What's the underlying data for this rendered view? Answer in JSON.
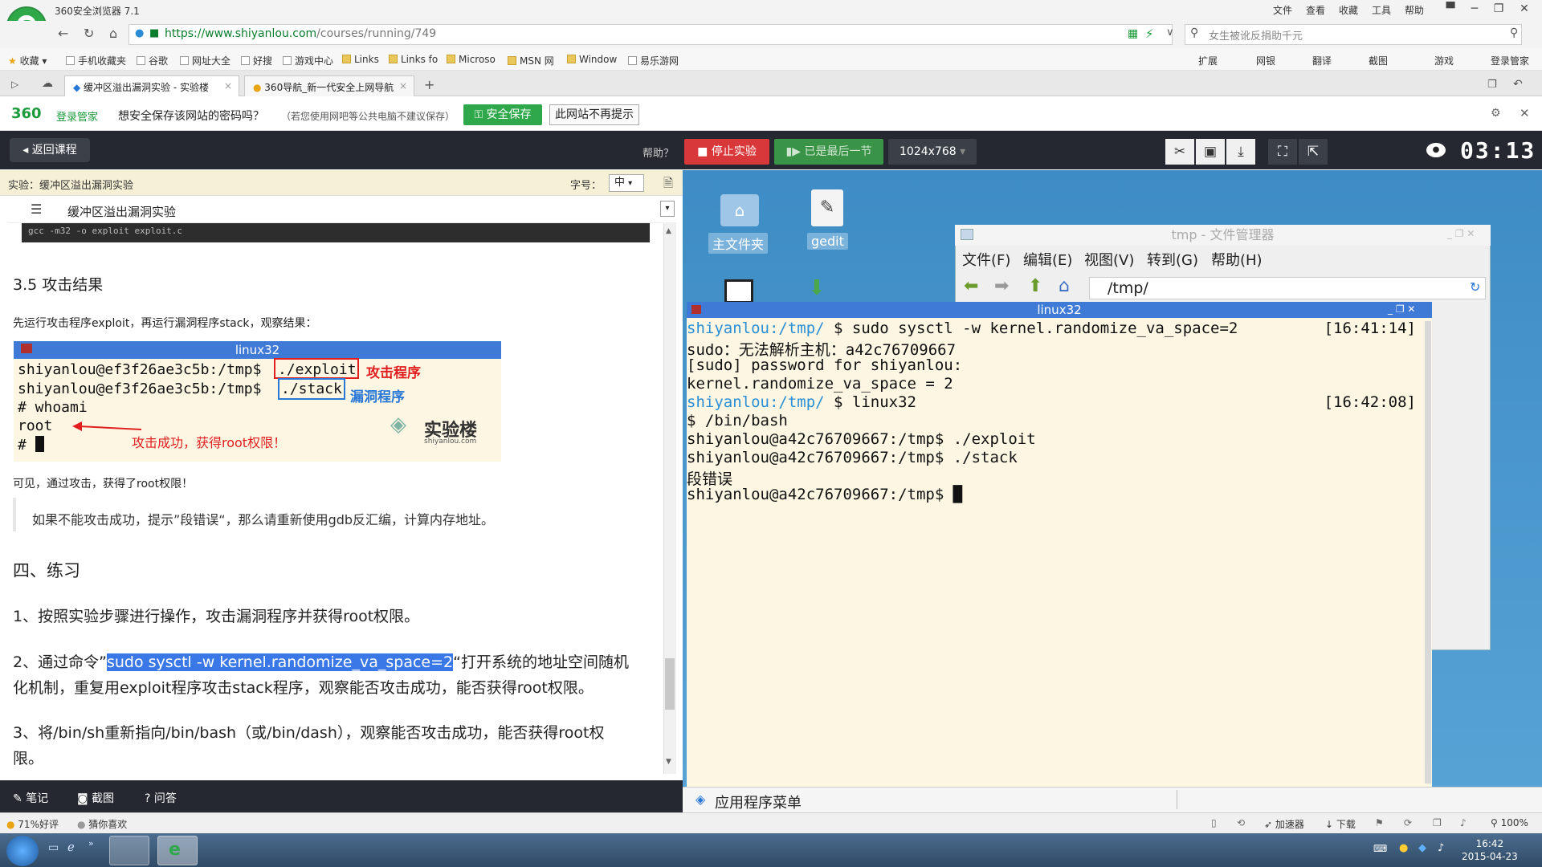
{
  "browser": {
    "title": "360安全浏览器 7.1",
    "menu": [
      "文件",
      "查看",
      "收藏",
      "工具",
      "帮助"
    ],
    "url_host": "https://www.shiyanlou.com",
    "url_path": "/courses/running/749",
    "search_placeholder": "女生被讹反捐助千元",
    "bookmarks": [
      "收藏",
      "手机收藏夹",
      "谷歌",
      "网址大全",
      "好搜",
      "游戏中心",
      "Links",
      "Links fo",
      "Microso",
      "MSN 网",
      "Window",
      "易乐游网"
    ],
    "toolbar_right": [
      "扩展",
      "网银",
      "翻译",
      "截图",
      "游戏",
      "登录管家"
    ],
    "tabs": [
      "缓冲区溢出漏洞实验 - 实验楼",
      "360导航_新一代安全上网导航"
    ],
    "pw_brand": "360",
    "pw_brand_label": "登录管家",
    "pw_question": "想安全保存该网站的密码吗？",
    "pw_note": "（若您使用网吧等公共电脑不建议保存）",
    "pw_save": "安全保存",
    "pw_never": "此网站不再提示"
  },
  "header": {
    "back": "返回课程",
    "help": "帮助？",
    "stop": "停止实验",
    "last": "已是最后一节",
    "resolution": "1024x768",
    "timer": "03:13"
  },
  "left": {
    "lab_title": "实验：缓冲区溢出漏洞实验",
    "font_label": "字号：",
    "font_value": "中",
    "doc_title": "缓冲区溢出漏洞实验",
    "code_line": "gcc -m32 -o exploit exploit.c",
    "h_result": "3.5 攻击结果",
    "p_run": "先运行攻击程序exploit，再运行漏洞程序stack，观察结果：",
    "shot": {
      "title": "linux32",
      "lines": [
        "shiyanlou@ef3f26ae3c5b:/tmp$ ",
        "shiyanlou@ef3f26ae3c5b:/tmp$ ",
        "# whoami",
        "root",
        "# "
      ],
      "cmd1": "./exploit",
      "cmd2": "./stack",
      "label1": "攻击程序",
      "label2": "漏洞程序",
      "annotation": "攻击成功，获得root权限！",
      "watermark": "实验楼",
      "watermark_url": "shiyanlou.com"
    },
    "p_seen": "可见，通过攻击，获得了root权限！",
    "quote": "如果不能攻击成功，提示”段错误“，那么请重新使用gdb反汇编，计算内存地址。",
    "h_practice": "四、练习",
    "item1": "1、按照实验步骤进行操作，攻击漏洞程序并获得root权限。",
    "item2a": "2、通过命令”",
    "item2cmd": "sudo sysctl -w kernel.randomize_va_space=2",
    "item2b": "“打开系统的地址空间随机",
    "item2c": "化机制，重复用exploit程序攻击stack程序，观察能否攻击成功，能否获得root权限。",
    "item3a": "3、将/bin/sh重新指向/bin/bash（或/bin/dash），观察能否攻击成功，能否获得root权",
    "item3b": "限。",
    "footer": [
      "笔记",
      "截图",
      "问答"
    ]
  },
  "desktop": {
    "icons": [
      "主文件夹",
      "gedit"
    ],
    "fm_title": "tmp - 文件管理器",
    "fm_menu": [
      "文件(F)",
      "编辑(E)",
      "视图(V)",
      "转到(G)",
      "帮助(H)"
    ],
    "fm_path": "/tmp/",
    "term_title": "linux32",
    "term": [
      {
        "prompt": "shiyanlou:/tmp/",
        "text": " $ sudo sysctl -w kernel.randomize_va_space=2",
        "time": "[16:41:14]"
      },
      {
        "prompt": "",
        "text": "sudo：无法解析主机：a42c76709667",
        "time": ""
      },
      {
        "prompt": "",
        "text": "[sudo] password for shiyanlou:",
        "time": ""
      },
      {
        "prompt": "",
        "text": "kernel.randomize_va_space = 2",
        "time": ""
      },
      {
        "prompt": "shiyanlou:/tmp/",
        "text": " $ linux32",
        "time": "[16:42:08]"
      },
      {
        "prompt": "",
        "text": "$ /bin/bash",
        "time": ""
      },
      {
        "prompt": "",
        "text": "shiyanlou@a42c76709667:/tmp$ ./exploit",
        "time": ""
      },
      {
        "prompt": "",
        "text": "shiyanlou@a42c76709667:/tmp$ ./stack",
        "time": ""
      },
      {
        "prompt": "",
        "text": "段错误",
        "time": ""
      },
      {
        "prompt": "",
        "text": "shiyanlou@a42c76709667:/tmp$ █",
        "time": ""
      }
    ],
    "app_menu": "应用程序菜单"
  },
  "status": {
    "rating": "71%好评",
    "guess": "猜你喜欢",
    "right": [
      "加速器",
      "下载",
      "100%"
    ]
  },
  "taskbar": {
    "time": "16:42",
    "date": "2015-04-23"
  }
}
